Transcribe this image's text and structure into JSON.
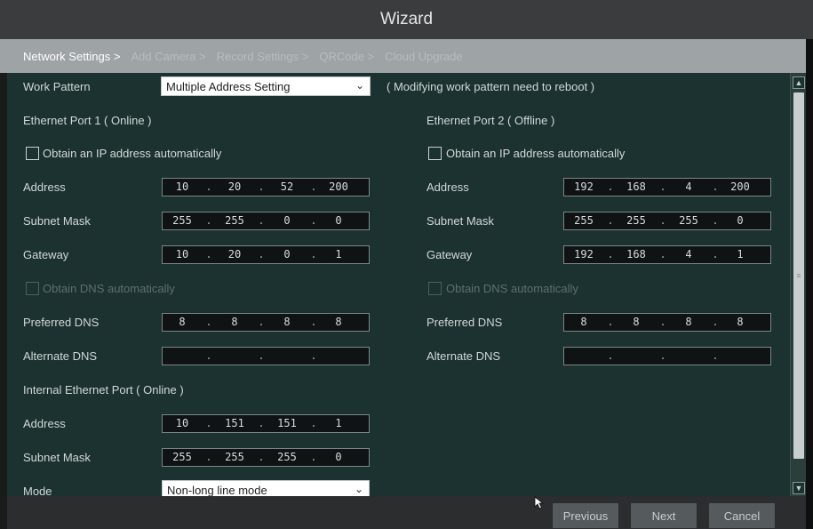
{
  "window": {
    "title": "Wizard"
  },
  "steps": [
    {
      "label": "Network Settings >",
      "active": true
    },
    {
      "label": "Add Camera >",
      "active": false
    },
    {
      "label": "Record Settings >",
      "active": false
    },
    {
      "label": "QRCode >",
      "active": false
    },
    {
      "label": "Cloud Upgrade",
      "active": false
    }
  ],
  "work_pattern": {
    "label": "Work Pattern",
    "value": "Multiple Address Setting",
    "note": "( Modifying work pattern need to reboot )"
  },
  "port1": {
    "title": "Ethernet Port 1 ( Online )",
    "obtain_ip_label": "Obtain an IP address automatically",
    "address_label": "Address",
    "address": [
      "10",
      "20",
      "52",
      "200"
    ],
    "subnet_label": "Subnet Mask",
    "subnet": [
      "255",
      "255",
      "0",
      "0"
    ],
    "gateway_label": "Gateway",
    "gateway": [
      "10",
      "20",
      "0",
      "1"
    ],
    "obtain_dns_label": "Obtain DNS automatically",
    "preferred_dns_label": "Preferred DNS",
    "preferred_dns": [
      "8",
      "8",
      "8",
      "8"
    ],
    "alternate_dns_label": "Alternate DNS",
    "alternate_dns": [
      "",
      "",
      "",
      ""
    ]
  },
  "port2": {
    "title": "Ethernet Port 2 ( Offline )",
    "obtain_ip_label": "Obtain an IP address automatically",
    "address_label": "Address",
    "address": [
      "192",
      "168",
      "4",
      "200"
    ],
    "subnet_label": "Subnet Mask",
    "subnet": [
      "255",
      "255",
      "255",
      "0"
    ],
    "gateway_label": "Gateway",
    "gateway": [
      "192",
      "168",
      "4",
      "1"
    ],
    "obtain_dns_label": "Obtain DNS automatically",
    "preferred_dns_label": "Preferred DNS",
    "preferred_dns": [
      "8",
      "8",
      "8",
      "8"
    ],
    "alternate_dns_label": "Alternate DNS",
    "alternate_dns": [
      "",
      "",
      "",
      ""
    ]
  },
  "internal": {
    "title": "Internal Ethernet Port ( Online )",
    "address_label": "Address",
    "address": [
      "10",
      "151",
      "151",
      "1"
    ],
    "subnet_label": "Subnet Mask",
    "subnet": [
      "255",
      "255",
      "255",
      "0"
    ],
    "mode_label": "Mode",
    "mode_value": "Non-long line mode"
  },
  "buttons": {
    "previous": "Previous",
    "next": "Next",
    "cancel": "Cancel"
  },
  "colors": {
    "panel": "#1c3230",
    "accent_header": "#9ea3a6",
    "titlebar": "#3a3c3d"
  }
}
